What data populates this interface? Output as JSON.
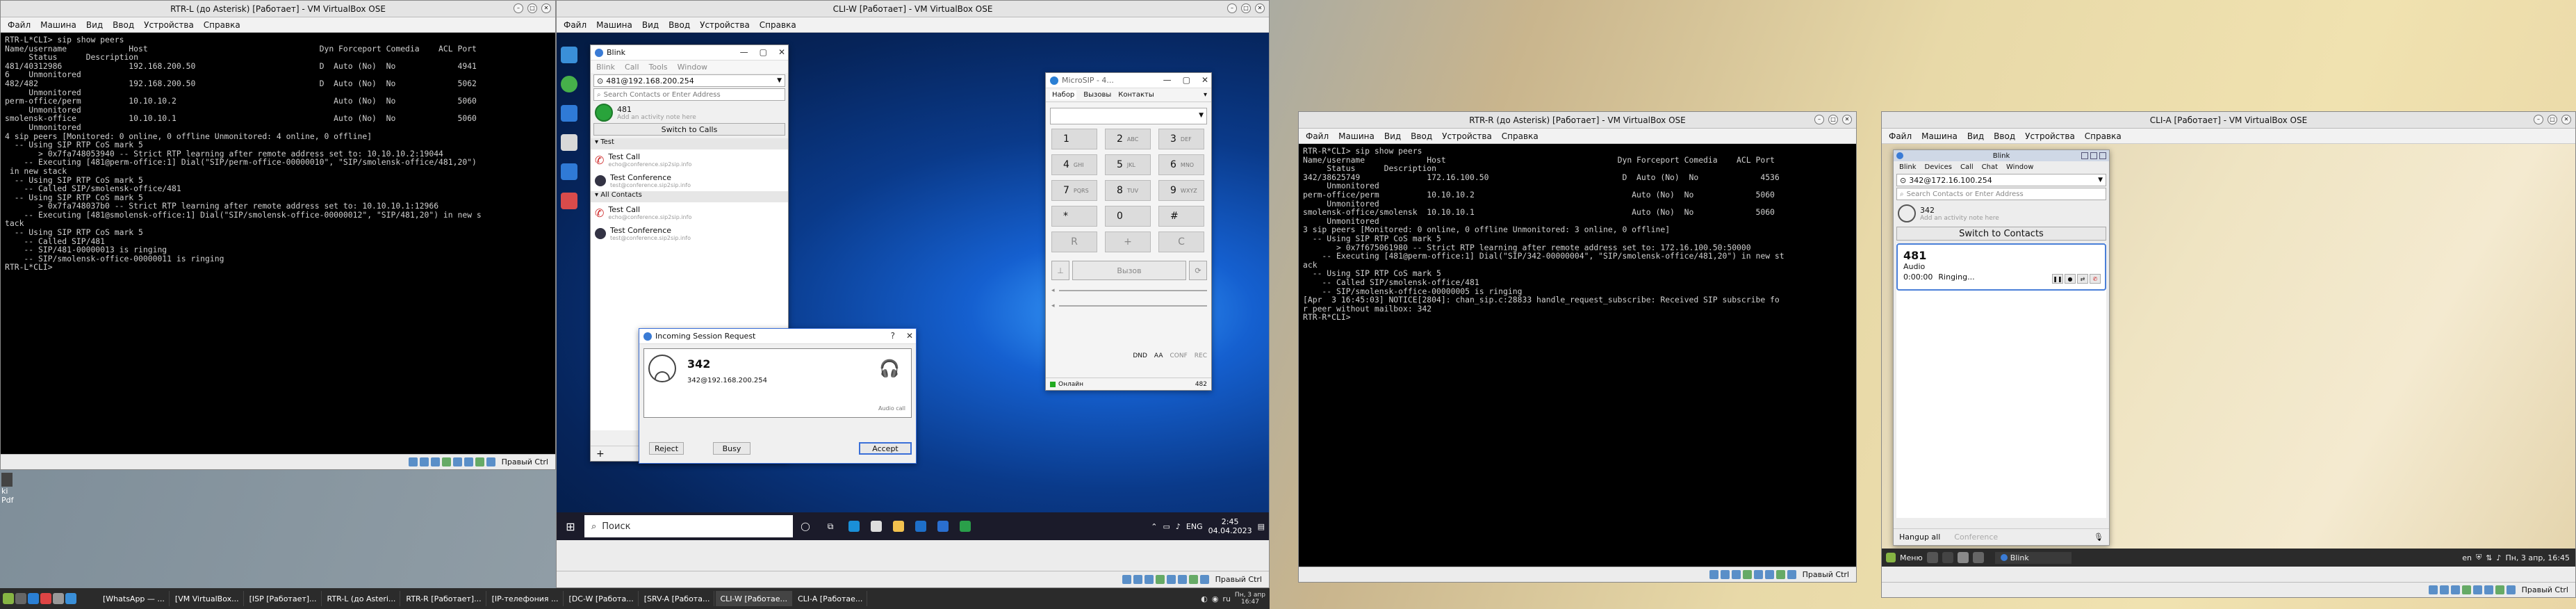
{
  "left_vm": {
    "title": "RTR-L (до Asterisk) [Работает] - VM VirtualBox OSE",
    "menu": [
      "Файл",
      "Машина",
      "Вид",
      "Ввод",
      "Устройства",
      "Справка"
    ],
    "console": "RTR-L*CLI> sip show peers\nName/username             Host                                    Dyn Forceport Comedia    ACL Port\n     Status      Description\n481/40312986              192.168.200.50                          D  Auto (No)  No             4941\n6    Unmonitored\n482/482                   192.168.200.50                          D  Auto (No)  No             5062\n     Unmonitored\nperm-office/perm          10.10.10.2                                 Auto (No)  No             5060\n     Unmonitored\nsmolensk-office           10.10.10.1                                 Auto (No)  No             5060\n     Unmonitored\n4 sip peers [Monitored: 0 online, 0 offline Unmonitored: 4 online, 0 offline]\n  -- Using SIP RTP CoS mark 5\n       > 0x7fa748053940 -- Strict RTP learning after remote address set to: 10.10.10.2:19044\n    -- Executing [481@perm-office:1] Dial(\"SIP/perm-office-00000010\", \"SIP/smolensk-office/481,20\")\n in new stack\n  -- Using SIP RTP CoS mark 5\n    -- Called SIP/smolensk-office/481\n  -- Using SIP RTP CoS mark 5\n       > 0x7fa748037b0 -- Strict RTP learning after remote address set to: 10.10.10.1:12966\n    -- Executing [481@smolensk-office:1] Dial(\"SIP/smolensk-office-00000012\", \"SIP/481,20\") in new s\ntack\n  -- Using SIP RTP CoS mark 5\n    -- Called SIP/481\n    -- SIP/481-00000013 is ringing\n    -- SIP/smolensk-office-00000011 is ringing\nRTR-L*CLI>",
    "host_key": "Правый Ctrl"
  },
  "center_vm": {
    "title": "CLI-W [Работает] - VM VirtualBox OSE",
    "menu": [
      "Файл",
      "Машина",
      "Вид",
      "Ввод",
      "Устройства",
      "Справка"
    ],
    "host_key": "Правый Ctrl",
    "blink": {
      "title": "Blink",
      "menu": [
        "Blink",
        "Call",
        "Tools",
        "Window"
      ],
      "account": "481@192.168.200.254",
      "search_placeholder": "Search Contacts or Enter Address",
      "user": "481",
      "note": "Add an activity note here",
      "switch": "Switch to Calls",
      "groups": [
        {
          "name": "Test",
          "items": [
            {
              "name": "Test Call",
              "sub": "echo@conference.sip2sip.info"
            },
            {
              "name": "Test Conference",
              "sub": "test@conference.sip2sip.info"
            }
          ]
        },
        {
          "name": "All Contacts",
          "items": [
            {
              "name": "Test Call",
              "sub": "echo@conference.sip2sip.info"
            },
            {
              "name": "Test Conference",
              "sub": "test@conference.sip2sip.info"
            }
          ]
        }
      ],
      "add": "+"
    },
    "microsip": {
      "title": "MicroSIP - 4...",
      "tabs": [
        "Набор",
        "Вызовы",
        "Контакты"
      ],
      "keys": [
        [
          "1",
          ""
        ],
        [
          "2",
          "ABC"
        ],
        [
          "3",
          "DEF"
        ],
        [
          "4",
          "GHI"
        ],
        [
          "5",
          "JKL"
        ],
        [
          "6",
          "MNO"
        ],
        [
          "7",
          "PQRS"
        ],
        [
          "8",
          "TUV"
        ],
        [
          "9",
          "WXYZ"
        ],
        [
          "*",
          ""
        ],
        [
          "0",
          ""
        ],
        [
          "#",
          ""
        ]
      ],
      "r_btn": "R",
      "plus_btn": "+",
      "c_btn": "C",
      "call_btn": "Вызов",
      "flags": [
        "DND",
        "AA",
        "CONF",
        "REC"
      ],
      "status": "Онлайн",
      "number": "482"
    },
    "incoming": {
      "title": "Incoming Session Request",
      "help": "?",
      "caller": "342",
      "address": "342@192.168.200.254",
      "media": "Audio call",
      "reject": "Reject",
      "busy": "Busy",
      "accept": "Accept"
    },
    "taskbar": {
      "search": "Поиск",
      "time": "2:45",
      "date": "04.04.2023",
      "lang": "ENG"
    }
  },
  "host_taskbar": {
    "items": [
      "[WhatsApp — ...",
      "[VM VirtualBox...",
      "[ISP [Работает]...",
      "RTR-L (до Asteri...",
      "RTR-R [Работает]...",
      "[IP-телефония ...",
      "[DC-W [Работа...",
      "[SRV-A [Работа...",
      "CLI-W [Работае...",
      "CLI-A [Работае..."
    ],
    "lang": "ru",
    "clock": "Пн, 3 апр\n16:47"
  },
  "desktop_file": "ki\nPdf",
  "right_vm": {
    "title": "RTR-R (до Asterisk) [Работает] - VM VirtualBox OSE",
    "menu": [
      "Файл",
      "Машина",
      "Вид",
      "Ввод",
      "Устройства",
      "Справка"
    ],
    "console": "RTR-R*CLI> sip show peers\nName/username             Host                                    Dyn Forceport Comedia    ACL Port\n     Status      Description\n342/38625749              172.16.100.50                            D  Auto (No)  No             4536\n     Unmonitored\nperm-office/perm          10.10.10.2                                 Auto (No)  No             5060\n     Unmonitored\nsmolensk-office/smolensk  10.10.10.1                                 Auto (No)  No             5060\n     Unmonitored\n3 sip peers [Monitored: 0 online, 0 offline Unmonitored: 3 online, 0 offline]\n  -- Using SIP RTP CoS mark 5\n       > 0x7f675061980 -- Strict RTP learning after remote address set to: 172.16.100.50:50000\n    -- Executing [481@perm-office:1] Dial(\"SIP/342-00000004\", \"SIP/smolensk-office/481,20\") in new st\nack\n  -- Using SIP RTP CoS mark 5\n    -- Called SIP/smolensk-office/481\n    -- SIP/smolensk-office-00000005 is ringing\n[Apr  3 16:45:03] NOTICE[2804]: chan_sip.c:28833 handle_request_subscribe: Received SIP subscribe fo\nr peer without mailbox: 342\nRTR-R*CLI>",
    "host_key": "Правый Ctrl"
  },
  "far_right_vm": {
    "title": "CLI-A [Работает] - VM VirtualBox OSE",
    "menu": [
      "Файл",
      "Машина",
      "Вид",
      "Ввод",
      "Устройства",
      "Справка"
    ],
    "host_key": "Правый Ctrl",
    "blink": {
      "title": "Blink",
      "menu": [
        "Blink",
        "Devices",
        "Call",
        "Chat",
        "Window"
      ],
      "account": "342@172.16.100.254",
      "search_placeholder": "Search Contacts or Enter Address",
      "user": "342",
      "note": "Add an activity note here",
      "switch": "Switch to Contacts",
      "call_name": "481",
      "call_media": "Audio",
      "call_time": "0:00:00",
      "call_state": "Ringing...",
      "hangup": "Hangup all",
      "conference": "Conference"
    },
    "taskbar": {
      "menu": "Меню",
      "app": "Blink",
      "lang": "en",
      "clock": "Пн, 3 апр, 16:45"
    }
  },
  "colors": {
    "terminal_bg": "#000000",
    "win_desktop": "#0a3a8a",
    "accept_border": "#3a6fd8",
    "mint_taskbar": "#2b2b2b"
  }
}
